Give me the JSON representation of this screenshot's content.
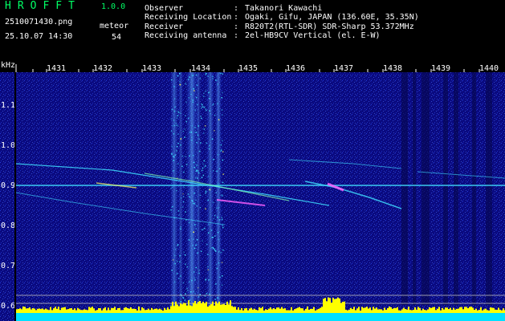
{
  "window": {
    "app_name": "HROFFT",
    "version": "1.0.0"
  },
  "capture": {
    "filename": "2510071430.png",
    "datetime": "25.10.07 14:30",
    "count_label": "meteor",
    "count_value": "54"
  },
  "station_info": [
    {
      "label": "Observer",
      "sep": ":",
      "value": "Takanori Kawachi"
    },
    {
      "label": "Receiving Location",
      "sep": ":",
      "value": "Ogaki, Gifu, JAPAN (136.60E, 35.35N)"
    },
    {
      "label": "Receiver",
      "sep": ":",
      "value": "R820T2(RTL-SDR) SDR-Sharp 53.372MHz"
    },
    {
      "label": "Receiving antenna",
      "sep": ":",
      "value": "2el-HB9CV Vertical (el. E-W)"
    }
  ],
  "spectrogram": {
    "y_unit": "kHz",
    "x_ticks": [
      "1431",
      "1432",
      "1433",
      "1434",
      "1435",
      "1436",
      "1437",
      "1438",
      "1439",
      "1440"
    ],
    "y_ticks": [
      "1.1",
      "1.0",
      "0.9",
      "0.8",
      "0.7",
      "0.6"
    ],
    "colors": {
      "background": "#0a0a80",
      "noise": "#2040ff",
      "signal": "#40e0ff",
      "intense": "#ffff60",
      "peak": "#ff60ff",
      "baseline_bars": "#ffff00",
      "baseline_cyan": "#00e0ff",
      "labels": "#ffffff"
    }
  }
}
